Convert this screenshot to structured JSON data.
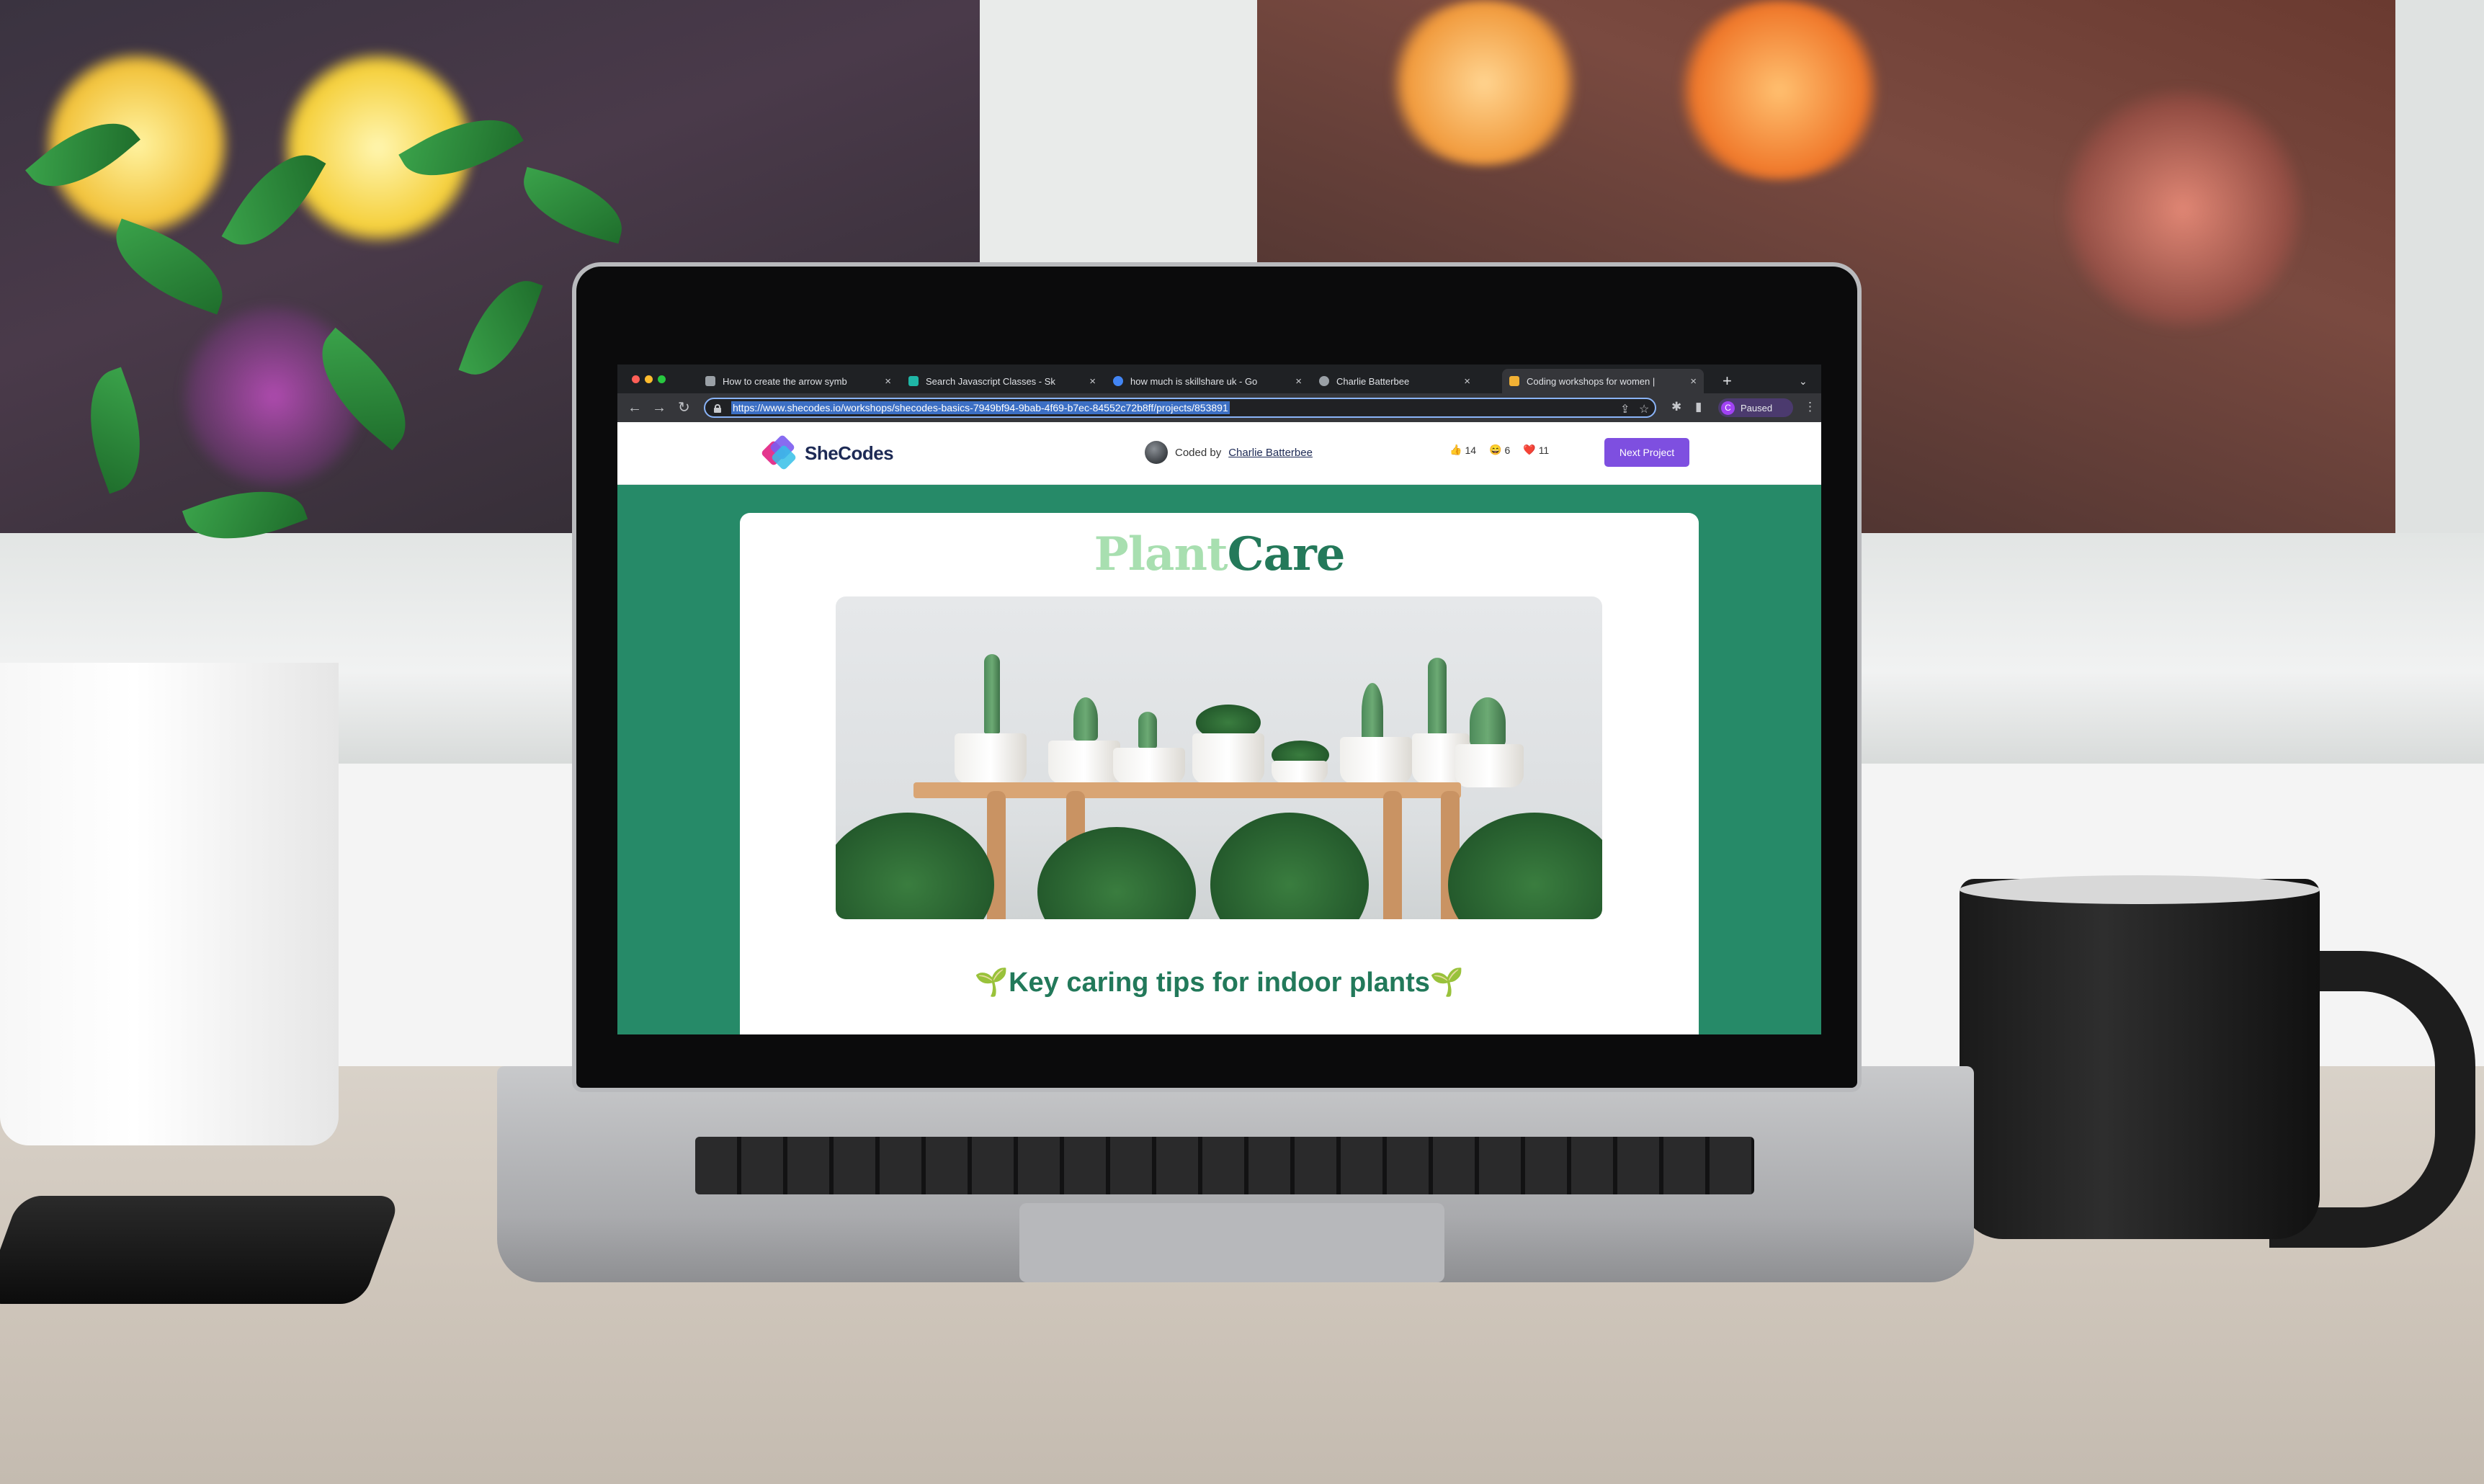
{
  "browser": {
    "tabs": [
      {
        "title": "How to create the arrow symb",
        "favicon_color": "#9aa0a6"
      },
      {
        "title": "Search Javascript Classes - Sk",
        "favicon_color": "#1fb6a6"
      },
      {
        "title": "how much is skillshare uk - Go",
        "favicon_color": "#4285f4"
      },
      {
        "title": "Charlie Batterbee",
        "favicon_color": "#9aa0a6"
      },
      {
        "title": "Coding workshops for women |",
        "favicon_color": "#f2b134"
      }
    ],
    "active_tab_index": 4,
    "url": "https://www.shecodes.io/workshops/shecodes-basics-7949bf94-9bab-4f69-b7ec-84552c72b8ff/projects/853891",
    "profile_initial": "C",
    "profile_status": "Paused"
  },
  "site_header": {
    "logo_text": "SheCodes",
    "coded_by_prefix": "Coded by",
    "author": "Charlie Batterbee",
    "reactions": [
      {
        "emoji": "👍",
        "count": "14"
      },
      {
        "emoji": "😄",
        "count": "6"
      },
      {
        "emoji": "❤️",
        "count": "11"
      }
    ],
    "next_button": "Next Project"
  },
  "project": {
    "brand_part1": "Plant",
    "brand_part2": "Care",
    "heading": "🌱Key caring tips for indoor plants🌱"
  }
}
